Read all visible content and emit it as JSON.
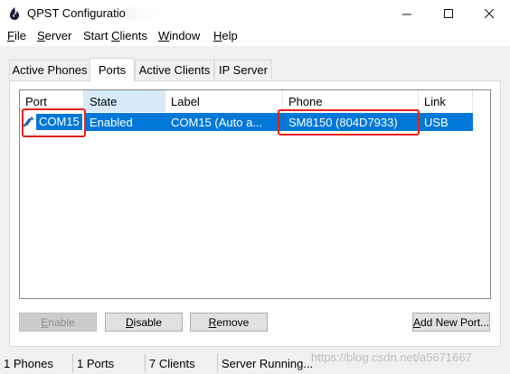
{
  "window": {
    "title": "QPST Configuratio",
    "minimize_glyph": "—",
    "maximize_glyph": "☐",
    "close_glyph": "✕"
  },
  "menu": [
    {
      "label": "File",
      "mnemonic": "F",
      "rest": "ile"
    },
    {
      "label": "Server",
      "mnemonic": "S",
      "rest": "erver"
    },
    {
      "label": "Start Clients",
      "pre": "Start ",
      "mnemonic": "C",
      "rest": "lients"
    },
    {
      "label": "Window",
      "mnemonic": "W",
      "rest": "indow"
    },
    {
      "label": "Help",
      "mnemonic": "H",
      "rest": "elp"
    }
  ],
  "tabs": [
    {
      "label": "Active Phones",
      "active": false
    },
    {
      "label": "Ports",
      "active": true
    },
    {
      "label": "Active Clients",
      "active": false
    },
    {
      "label": "IP Server",
      "active": false
    }
  ],
  "ports_table": {
    "columns": [
      "Port",
      "State",
      "Label",
      "Phone",
      "Link"
    ],
    "rows": [
      {
        "port": "COM15",
        "state": "Enabled",
        "label": "COM15 (Auto a...",
        "phone": "SM8150 (804D7933)",
        "link": "USB"
      }
    ]
  },
  "buttons": {
    "enable": {
      "mnemonic": "E",
      "rest": "nable",
      "enabled": false
    },
    "disable": {
      "mnemonic": "D",
      "rest": "isable",
      "enabled": true
    },
    "remove": {
      "mnemonic": "R",
      "rest": "emove",
      "enabled": true
    },
    "add_new_port": {
      "mnemonic": "A",
      "rest": "dd New Port...",
      "enabled": true
    }
  },
  "status_bar": [
    "1 Phones",
    "1 Ports",
    "7 Clients",
    "Server Running..."
  ],
  "watermark": "https://blog.csdn.net/a5671667",
  "colors": {
    "selection": "#0078d7",
    "annotation": "#e8201a",
    "sorted_header": "#d9ebf9"
  },
  "icons": {
    "app": "qpst-app-icon",
    "port": "serial-port-icon"
  }
}
